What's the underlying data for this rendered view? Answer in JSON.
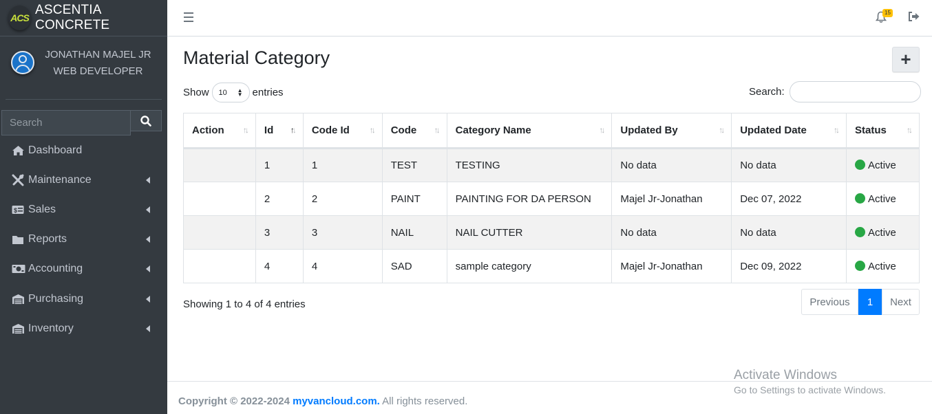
{
  "brand": {
    "logo": "ACS",
    "name": "ASCENTIA CONCRETE"
  },
  "user": {
    "name": "JONATHAN MAJEL JR",
    "role": "WEB DEVELOPER"
  },
  "sidebar_search": {
    "placeholder": "Search"
  },
  "nav": [
    {
      "label": "Dashboard",
      "icon": "home-icon",
      "has_children": false
    },
    {
      "label": "Maintenance",
      "icon": "tools-icon",
      "has_children": true
    },
    {
      "label": "Sales",
      "icon": "money-card-icon",
      "has_children": true
    },
    {
      "label": "Reports",
      "icon": "folder-icon",
      "has_children": true
    },
    {
      "label": "Accounting",
      "icon": "money-bill-icon",
      "has_children": true
    },
    {
      "label": "Purchasing",
      "icon": "warehouse-icon",
      "has_children": true
    },
    {
      "label": "Inventory",
      "icon": "warehouse-icon",
      "has_children": true
    }
  ],
  "topbar": {
    "notification_count": "15"
  },
  "page": {
    "title": "Material Category"
  },
  "table_controls": {
    "show_label": "Show",
    "entries_value": "10",
    "entries_label": "entries",
    "search_label": "Search:"
  },
  "table": {
    "columns": [
      "Action",
      "Id",
      "Code Id",
      "Code",
      "Category Name",
      "Updated By",
      "Updated Date",
      "Status"
    ],
    "rows": [
      {
        "action": "",
        "id": "1",
        "code_id": "1",
        "code": "TEST",
        "category_name": "TESTING",
        "updated_by": "No data",
        "updated_date": "No data",
        "status": "Active"
      },
      {
        "action": "",
        "id": "2",
        "code_id": "2",
        "code": "PAINT",
        "category_name": "PAINTING FOR DA PERSON",
        "updated_by": "Majel Jr-Jonathan",
        "updated_date": "Dec 07, 2022",
        "status": "Active"
      },
      {
        "action": "",
        "id": "3",
        "code_id": "3",
        "code": "NAIL",
        "category_name": "NAIL CUTTER",
        "updated_by": "No data",
        "updated_date": "No data",
        "status": "Active"
      },
      {
        "action": "",
        "id": "4",
        "code_id": "4",
        "code": "SAD",
        "category_name": "sample category",
        "updated_by": "Majel Jr-Jonathan",
        "updated_date": "Dec 09, 2022",
        "status": "Active"
      }
    ]
  },
  "table_info": "Showing 1 to 4 of 4 entries",
  "pagination": {
    "previous": "Previous",
    "current": "1",
    "next": "Next"
  },
  "footer": {
    "prefix": "Copyright © 2022-2024 ",
    "link": "myvancloud.com.",
    "suffix": " All rights reserved."
  },
  "watermark": {
    "title": "Activate Windows",
    "subtitle": "Go to Settings to activate Windows."
  },
  "colors": {
    "sidebar": "#343a40",
    "accent": "#007bff",
    "active_status": "#28a745",
    "badge": "#ffc107"
  }
}
